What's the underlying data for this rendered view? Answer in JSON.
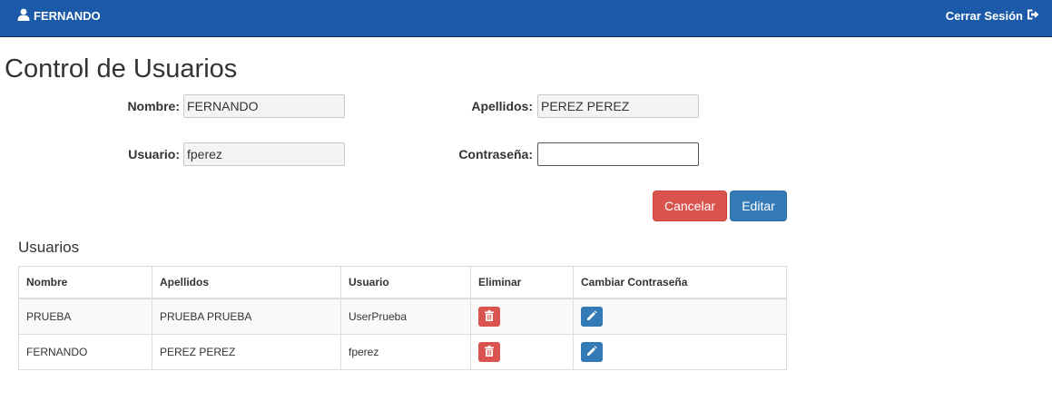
{
  "navbar": {
    "user_name": "FERNANDO",
    "logout_label": "Cerrar Sesión"
  },
  "page": {
    "title": "Control de Usuarios"
  },
  "form": {
    "nombre_label": "Nombre:",
    "nombre_value": "FERNANDO",
    "apellidos_label": "Apellidos:",
    "apellidos_value": "PEREZ PEREZ",
    "usuario_label": "Usuario:",
    "usuario_value": "fperez",
    "contrasena_label": "Contraseña:",
    "contrasena_value": "",
    "cancel_label": "Cancelar",
    "edit_label": "Editar"
  },
  "users_section": {
    "title": "Usuarios",
    "headers": [
      "Nombre",
      "Apellidos",
      "Usuario",
      "Eliminar",
      "Cambiar Contraseña"
    ],
    "rows": [
      {
        "nombre": "PRUEBA",
        "apellidos": "PRUEBA PRUEBA",
        "usuario": "UserPrueba"
      },
      {
        "nombre": "FERNANDO",
        "apellidos": "PEREZ PEREZ",
        "usuario": "fperez"
      }
    ]
  },
  "colors": {
    "navbar": "#1a5aa8",
    "danger": "#d9534f",
    "primary": "#337ab7"
  },
  "icons": {
    "user": "user-icon",
    "logout": "logout-icon",
    "delete": "trash-icon",
    "edit": "pencil-icon"
  }
}
